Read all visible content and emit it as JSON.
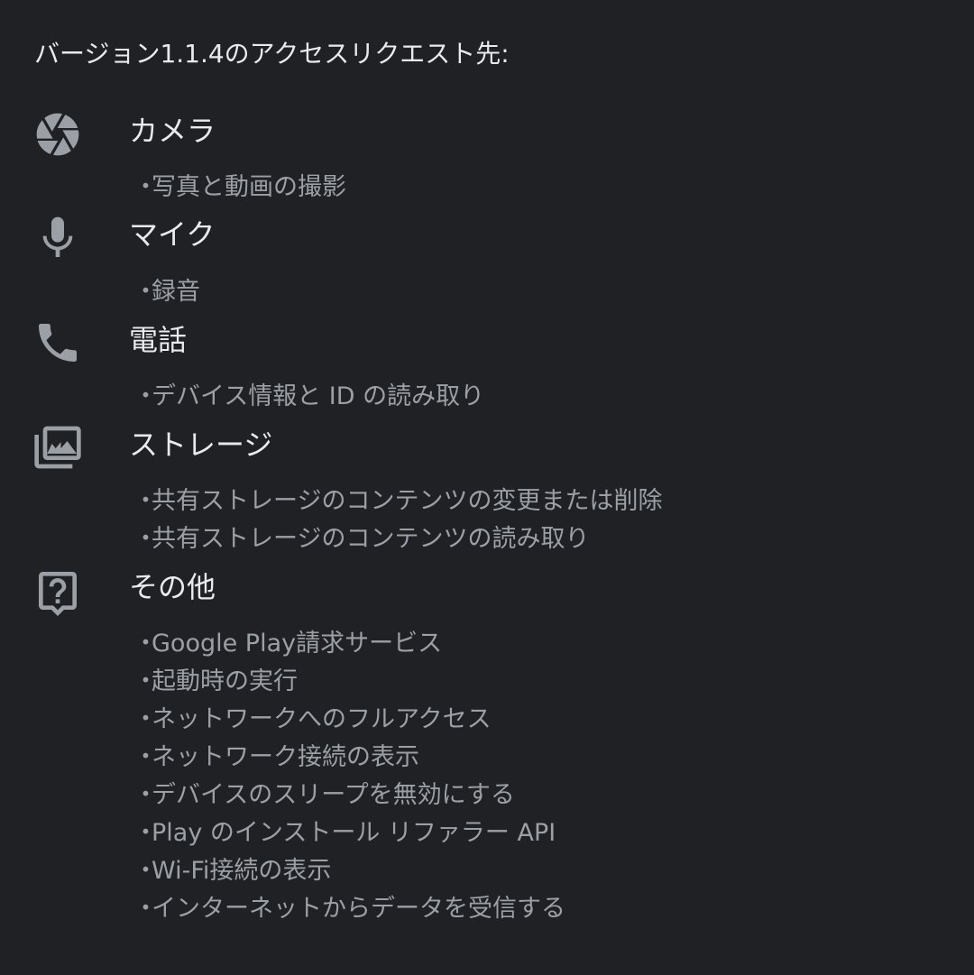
{
  "header": "バージョン1.1.4のアクセスリクエスト先:",
  "groups": [
    {
      "icon": "camera-aperture-icon",
      "title": "カメラ",
      "items": [
        "写真と動画の撮影"
      ]
    },
    {
      "icon": "microphone-icon",
      "title": "マイク",
      "items": [
        "録音"
      ]
    },
    {
      "icon": "phone-icon",
      "title": "電話",
      "items": [
        "デバイス情報と ID の読み取り"
      ]
    },
    {
      "icon": "photo-library-icon",
      "title": "ストレージ",
      "items": [
        "共有ストレージのコンテンツの変更または削除",
        "共有ストレージのコンテンツの読み取り"
      ]
    },
    {
      "icon": "help-question-icon",
      "title": "その他",
      "items": [
        "Google Play請求サービス",
        "起動時の実行",
        "ネットワークへのフルアクセス",
        "ネットワーク接続の表示",
        "デバイスのスリープを無効にする",
        "Play のインストール リファラー API",
        "Wi-Fi接続の表示",
        "インターネットからデータを受信する"
      ]
    }
  ],
  "bullet": "・",
  "colors": {
    "background": "#202124",
    "primary_text": "#e8eaed",
    "secondary_text": "#9aa0a6"
  }
}
